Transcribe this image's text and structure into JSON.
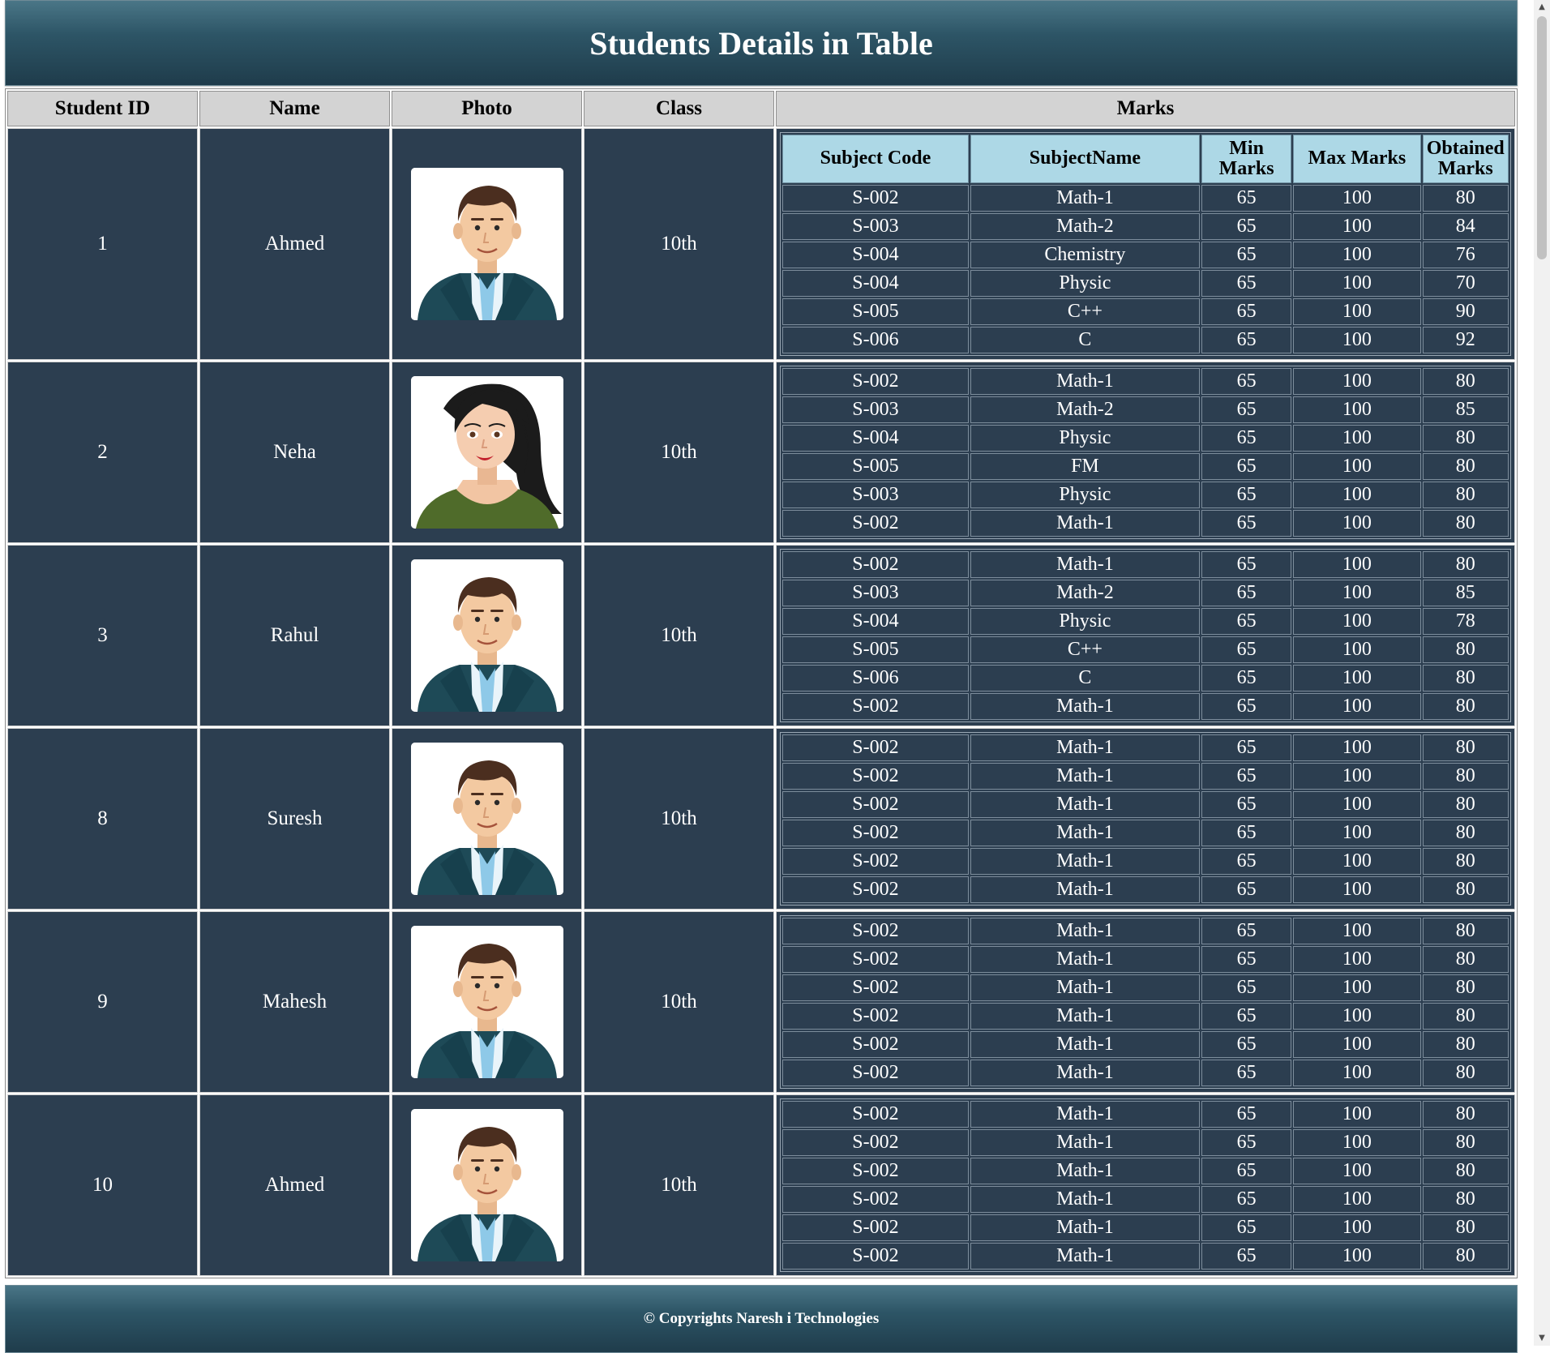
{
  "page": {
    "title": "Students Details in Table",
    "footer": "© Copyrights Naresh i Technologies"
  },
  "columns": [
    "Student ID",
    "Name",
    "Photo",
    "Class",
    "Marks"
  ],
  "marks_columns": [
    "Subject Code",
    "SubjectName",
    "Min Marks",
    "Max Marks",
    "Obtained Marks"
  ],
  "students": [
    {
      "id": "1",
      "name": "Ahmed",
      "class": "10th",
      "photo": "male-avatar-icon",
      "marks": [
        [
          "S-002",
          "Math-1",
          "65",
          "100",
          "80"
        ],
        [
          "S-003",
          "Math-2",
          "65",
          "100",
          "84"
        ],
        [
          "S-004",
          "Chemistry",
          "65",
          "100",
          "76"
        ],
        [
          "S-004",
          "Physic",
          "65",
          "100",
          "70"
        ],
        [
          "S-005",
          "C++",
          "65",
          "100",
          "90"
        ],
        [
          "S-006",
          "C",
          "65",
          "100",
          "92"
        ]
      ]
    },
    {
      "id": "2",
      "name": "Neha",
      "class": "10th",
      "photo": "female-avatar-icon",
      "marks": [
        [
          "S-002",
          "Math-1",
          "65",
          "100",
          "80"
        ],
        [
          "S-003",
          "Math-2",
          "65",
          "100",
          "85"
        ],
        [
          "S-004",
          "Physic",
          "65",
          "100",
          "80"
        ],
        [
          "S-005",
          "FM",
          "65",
          "100",
          "80"
        ],
        [
          "S-003",
          "Physic",
          "65",
          "100",
          "80"
        ],
        [
          "S-002",
          "Math-1",
          "65",
          "100",
          "80"
        ]
      ]
    },
    {
      "id": "3",
      "name": "Rahul",
      "class": "10th",
      "photo": "male-avatar-icon",
      "marks": [
        [
          "S-002",
          "Math-1",
          "65",
          "100",
          "80"
        ],
        [
          "S-003",
          "Math-2",
          "65",
          "100",
          "85"
        ],
        [
          "S-004",
          "Physic",
          "65",
          "100",
          "78"
        ],
        [
          "S-005",
          "C++",
          "65",
          "100",
          "80"
        ],
        [
          "S-006",
          "C",
          "65",
          "100",
          "80"
        ],
        [
          "S-002",
          "Math-1",
          "65",
          "100",
          "80"
        ]
      ]
    },
    {
      "id": "8",
      "name": "Suresh",
      "class": "10th",
      "photo": "male-avatar-icon",
      "marks": [
        [
          "S-002",
          "Math-1",
          "65",
          "100",
          "80"
        ],
        [
          "S-002",
          "Math-1",
          "65",
          "100",
          "80"
        ],
        [
          "S-002",
          "Math-1",
          "65",
          "100",
          "80"
        ],
        [
          "S-002",
          "Math-1",
          "65",
          "100",
          "80"
        ],
        [
          "S-002",
          "Math-1",
          "65",
          "100",
          "80"
        ],
        [
          "S-002",
          "Math-1",
          "65",
          "100",
          "80"
        ]
      ]
    },
    {
      "id": "9",
      "name": "Mahesh",
      "class": "10th",
      "photo": "male-avatar-icon",
      "marks": [
        [
          "S-002",
          "Math-1",
          "65",
          "100",
          "80"
        ],
        [
          "S-002",
          "Math-1",
          "65",
          "100",
          "80"
        ],
        [
          "S-002",
          "Math-1",
          "65",
          "100",
          "80"
        ],
        [
          "S-002",
          "Math-1",
          "65",
          "100",
          "80"
        ],
        [
          "S-002",
          "Math-1",
          "65",
          "100",
          "80"
        ],
        [
          "S-002",
          "Math-1",
          "65",
          "100",
          "80"
        ]
      ]
    },
    {
      "id": "10",
      "name": "Ahmed",
      "class": "10th",
      "photo": "male-avatar-icon",
      "marks": [
        [
          "S-002",
          "Math-1",
          "65",
          "100",
          "80"
        ],
        [
          "S-002",
          "Math-1",
          "65",
          "100",
          "80"
        ],
        [
          "S-002",
          "Math-1",
          "65",
          "100",
          "80"
        ],
        [
          "S-002",
          "Math-1",
          "65",
          "100",
          "80"
        ],
        [
          "S-002",
          "Math-1",
          "65",
          "100",
          "80"
        ],
        [
          "S-002",
          "Math-1",
          "65",
          "100",
          "80"
        ]
      ]
    }
  ],
  "colors": {
    "header_bg": "#2d5566",
    "row_bg": "#2c3e50",
    "column_header_bg": "#d3d3d3",
    "marks_header_bg": "#add8e6"
  }
}
